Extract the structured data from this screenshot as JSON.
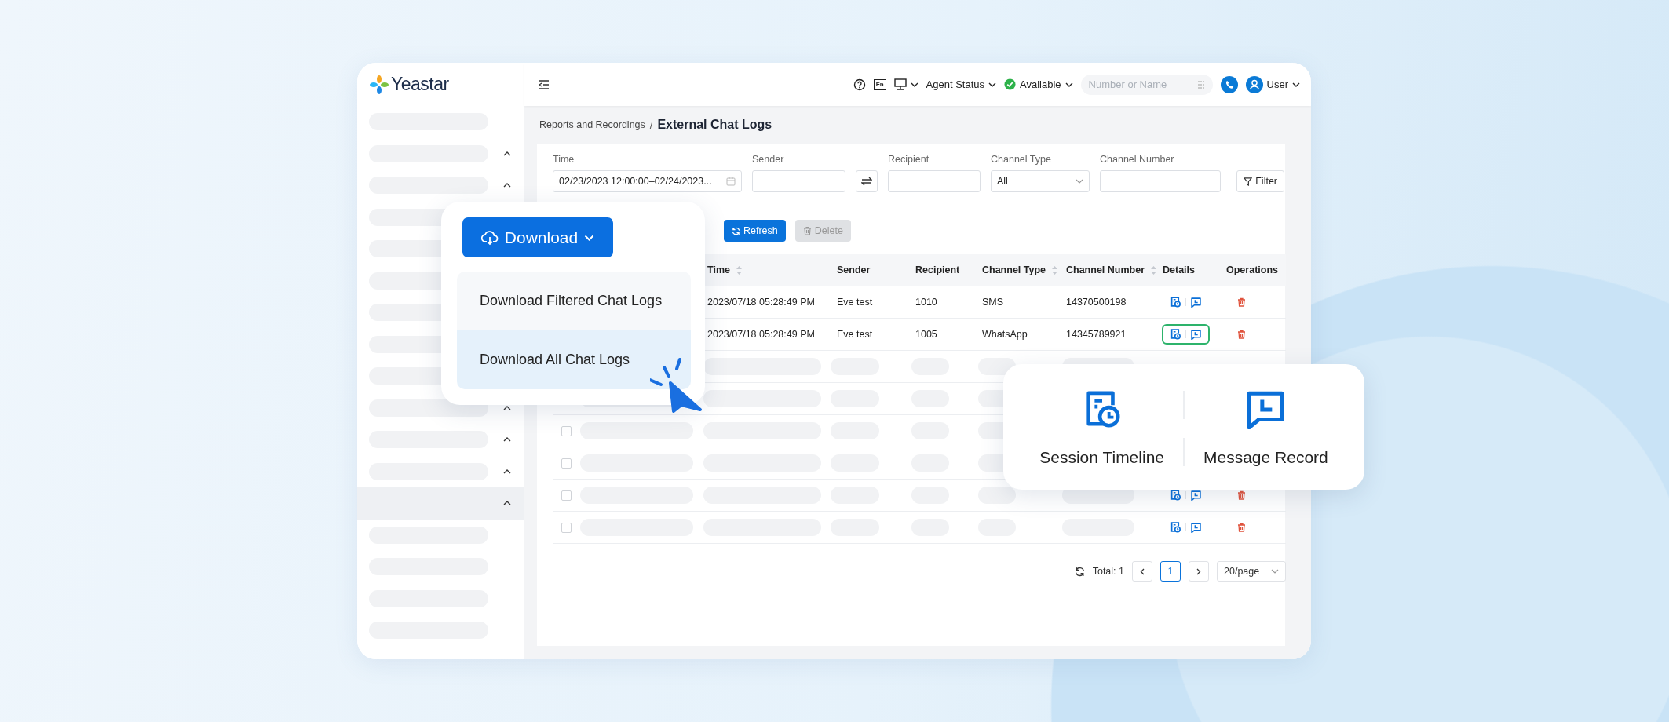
{
  "brand": {
    "name": "Yeastar"
  },
  "sidebar": {
    "items": [
      {
        "expandable": false,
        "selected": false
      },
      {
        "expandable": true,
        "selected": false
      },
      {
        "expandable": true,
        "selected": false
      },
      {
        "selected": false
      },
      {
        "selected": false
      },
      {
        "selected": false
      },
      {
        "selected": false
      },
      {
        "selected": false
      },
      {
        "selected": false
      },
      {
        "expandable": true,
        "selected": false
      },
      {
        "expandable": true,
        "selected": false
      },
      {
        "expandable": true,
        "selected": false
      },
      {
        "expandable": true,
        "selected": true
      },
      {
        "expandable": false,
        "selected": false
      },
      {
        "expandable": false,
        "selected": false
      },
      {
        "expandable": false,
        "selected": false
      },
      {
        "expandable": false,
        "selected": false
      }
    ]
  },
  "top_bar": {
    "function_key": "Fn",
    "agent_status": "Agent Status",
    "availability": "Available",
    "search": {
      "placeholder": "Number or Name"
    },
    "user": "User"
  },
  "breadcrumb": {
    "parent": "Reports and Recordings",
    "separator": "/",
    "current": "External Chat Logs"
  },
  "filters": [
    {
      "kind": "date-range",
      "label": "Time",
      "value": "02/23/2023 12:00:00–02/24/2023..."
    },
    {
      "kind": "text",
      "label": "Sender"
    },
    {
      "kind": "swap"
    },
    {
      "kind": "text",
      "label": "Recipient"
    },
    {
      "kind": "select",
      "label": "Channel Type",
      "value": "All"
    },
    {
      "kind": "text",
      "label": "Channel Number"
    }
  ],
  "filter_button": "Filter",
  "toolbar": {
    "buttons": [
      {
        "label": "Refresh",
        "disabled": false
      },
      {
        "label": "Delete",
        "disabled": true
      }
    ]
  },
  "table": {
    "columns": [
      {
        "label": "Time",
        "sortable": true
      },
      {
        "label": "Sender",
        "sortable": false
      },
      {
        "label": "Recipient",
        "sortable": false
      },
      {
        "label": "Channel Type",
        "sortable": true
      },
      {
        "label": "Channel Number",
        "sortable": true
      },
      {
        "label": "Details",
        "sortable": false
      },
      {
        "label": "Operations",
        "sortable": false
      }
    ],
    "rows": [
      {
        "kind": "data",
        "time": "2023/07/18 05:28:49 PM",
        "sender": "Eve test",
        "recipient": "1010",
        "channel_type": "SMS",
        "channel_number": "14370500198",
        "highlighted": false
      },
      {
        "kind": "data",
        "time": "2023/07/18 05:28:49 PM",
        "sender": "Eve test",
        "recipient": "1005",
        "channel_type": "WhatsApp",
        "channel_number": "14345789921",
        "highlighted": true
      },
      {
        "kind": "placeholder",
        "actions": false
      },
      {
        "kind": "placeholder",
        "actions": false
      },
      {
        "kind": "placeholder",
        "checked": false,
        "actions": false
      },
      {
        "kind": "placeholder",
        "checked": false,
        "actions": false
      },
      {
        "kind": "placeholder",
        "checked": false,
        "actions": true
      },
      {
        "kind": "placeholder",
        "checked": false,
        "actions": true
      }
    ]
  },
  "pagination": {
    "total": "Total: 1",
    "pages": [
      {
        "label": "1",
        "selected": true
      }
    ],
    "page_size": "20/page"
  },
  "download_menu": {
    "button": "Download",
    "items": [
      {
        "label": "Download Filtered Chat Logs",
        "selected": false
      },
      {
        "label": "Download All Chat Logs",
        "selected": true
      }
    ]
  },
  "details_popup": {
    "items": [
      {
        "kind": "timeline",
        "label": "Session Timeline"
      },
      {
        "kind": "message",
        "label": "Message Record"
      }
    ]
  }
}
